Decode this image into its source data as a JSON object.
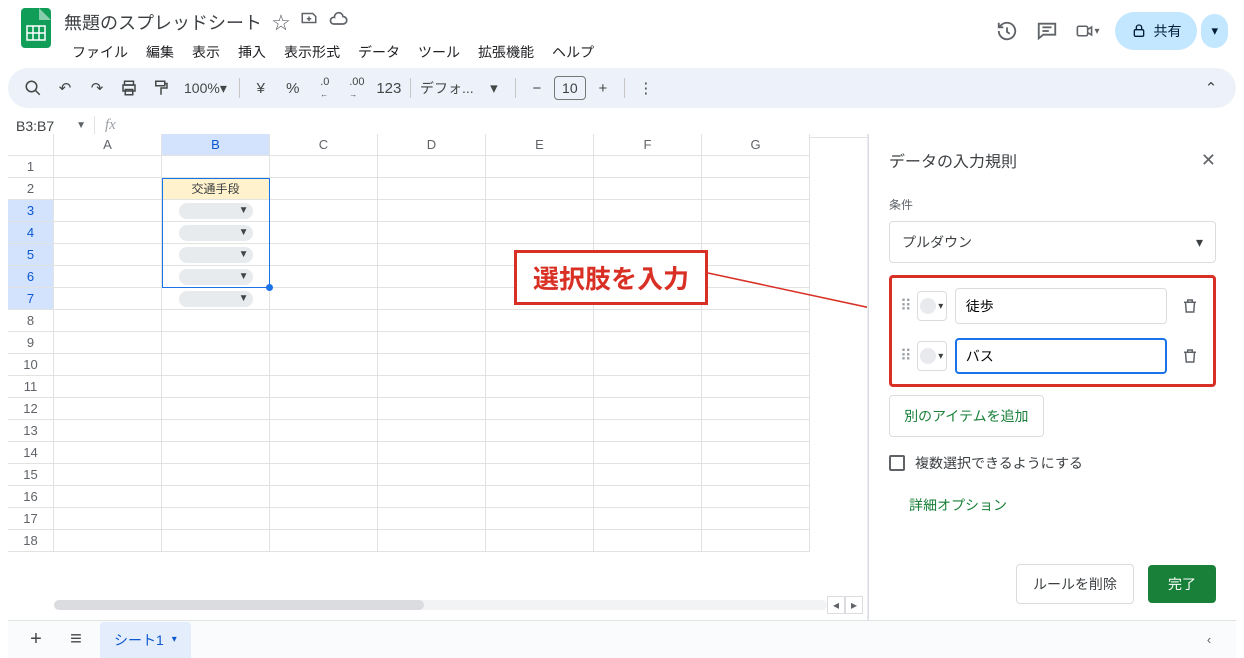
{
  "doc_title": "無題のスプレッドシート",
  "menus": [
    "ファイル",
    "編集",
    "表示",
    "挿入",
    "表示形式",
    "データ",
    "ツール",
    "拡張機能",
    "ヘルプ"
  ],
  "share_label": "共有",
  "toolbar": {
    "zoom": "100%",
    "currency": "¥",
    "percent": "%",
    "dec_dec": ".0",
    "dec_inc": ".00",
    "num_123": "123",
    "font": "デフォ...",
    "minus": "−",
    "font_size": "10",
    "plus": "+"
  },
  "name_box": "B3:B7",
  "fx": "fx",
  "columns": [
    "A",
    "B",
    "C",
    "D",
    "E",
    "F",
    "G"
  ],
  "rows": [
    "1",
    "2",
    "3",
    "4",
    "5",
    "6",
    "7",
    "8",
    "9",
    "10",
    "11",
    "12",
    "13",
    "14",
    "15",
    "16",
    "17",
    "18"
  ],
  "cell_b2": "交通手段",
  "annotation": "選択肢を入力",
  "panel": {
    "title": "データの入力規則",
    "criteria_label": "条件",
    "criteria_value": "プルダウン",
    "items": [
      {
        "value": "徒歩",
        "focused": false
      },
      {
        "value": "バス",
        "focused": true
      }
    ],
    "add_item": "別のアイテムを追加",
    "multi_select": "複数選択できるようにする",
    "advanced": "詳細オプション",
    "delete_rule": "ルールを削除",
    "done": "完了"
  },
  "sheet_tab": "シート1"
}
